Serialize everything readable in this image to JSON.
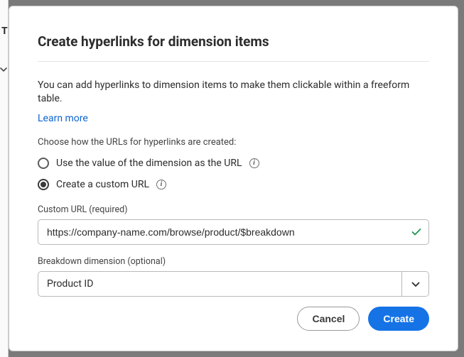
{
  "dialog": {
    "title": "Create hyperlinks for dimension items",
    "description": "You can add hyperlinks to dimension items to make them clickable within a freeform table.",
    "learn_more": "Learn more",
    "choose_label": "Choose how the URLs for hyperlinks are created:",
    "radio_value_label": "Use the value of the dimension as the URL",
    "radio_custom_label": "Create a custom URL",
    "custom_url_label": "Custom URL (required)",
    "custom_url_value": "https://company-name.com/browse/product/$breakdown",
    "breakdown_label": "Breakdown dimension (optional)",
    "breakdown_value": "Product ID",
    "cancel": "Cancel",
    "create": "Create"
  },
  "background": {
    "t_char": "T"
  }
}
